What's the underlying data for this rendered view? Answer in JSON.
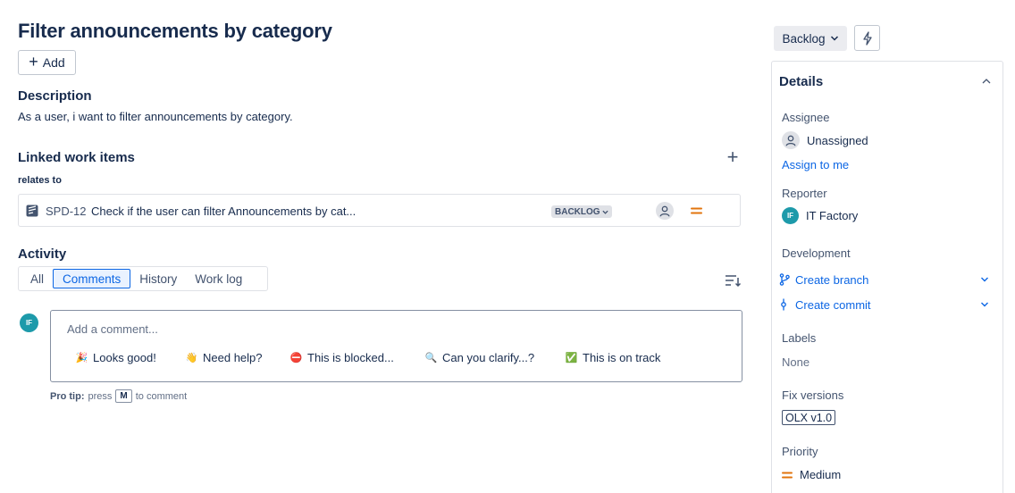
{
  "issue": {
    "title": "Filter announcements by category",
    "add_label": "Add"
  },
  "description": {
    "heading": "Description",
    "text": "As a user, i want to filter announcements by category."
  },
  "linked": {
    "heading": "Linked work items",
    "relation": "relates to",
    "items": [
      {
        "key": "SPD-12",
        "summary": "Check if the user can filter Announcements by cat...",
        "status": "BACKLOG",
        "priority_color": "#e2740d",
        "icon": "story-icon"
      }
    ]
  },
  "activity": {
    "heading": "Activity",
    "tabs": [
      "All",
      "Comments",
      "History",
      "Work log"
    ],
    "active_tab": "Comments",
    "avatar_initials": "IF",
    "comment_placeholder": "Add a comment...",
    "quick_replies": [
      {
        "label": "Looks good!",
        "icon": "party-popper-icon",
        "emoji": "🎉"
      },
      {
        "label": "Need help?",
        "icon": "waving-hand-icon",
        "emoji": "👋"
      },
      {
        "label": "This is blocked...",
        "icon": "no-entry-icon",
        "emoji": "⛔"
      },
      {
        "label": "Can you clarify...?",
        "icon": "magnifier-icon",
        "emoji": "🔍"
      },
      {
        "label": "This is on track",
        "icon": "check-box-icon",
        "emoji": "✅"
      }
    ],
    "protip_label": "Pro tip:",
    "protip_press": "press",
    "protip_key": "M",
    "protip_suffix": "to comment"
  },
  "sidebar": {
    "status": "Backlog",
    "details_heading": "Details",
    "assignee_label": "Assignee",
    "assignee_value": "Unassigned",
    "assign_to_me": "Assign to me",
    "reporter_label": "Reporter",
    "reporter_initials": "IF",
    "reporter_value": "IT Factory",
    "development_label": "Development",
    "create_branch": "Create branch",
    "create_commit": "Create commit",
    "labels_label": "Labels",
    "labels_value": "None",
    "fix_versions_label": "Fix versions",
    "fix_version": "OLX v1.0",
    "priority_label": "Priority",
    "priority_value": "Medium"
  },
  "colors": {
    "link": "#0c66e4",
    "avatar": "#1d9aaa",
    "priority_medium": "#e2740d"
  }
}
